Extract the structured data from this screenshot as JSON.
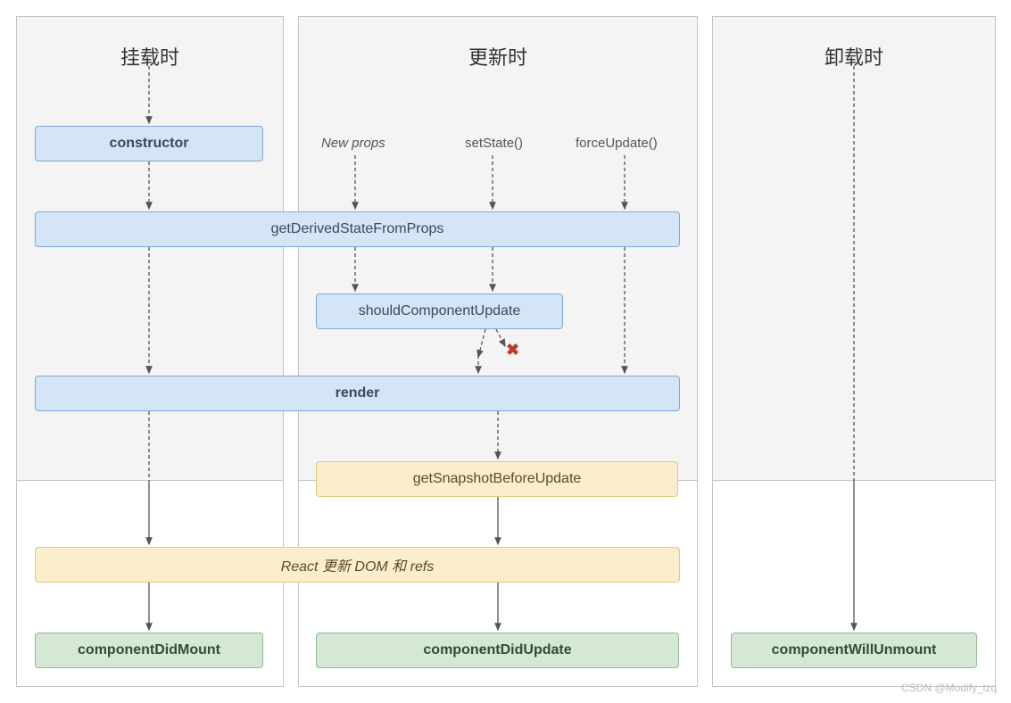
{
  "columns": {
    "mount": {
      "title": "挂载时"
    },
    "update": {
      "title": "更新时"
    },
    "unmount": {
      "title": "卸载时"
    }
  },
  "triggers": {
    "newProps": "New props",
    "setState": "setState()",
    "forceUpdate": "forceUpdate()"
  },
  "boxes": {
    "constructor": "constructor",
    "getDerived": "getDerivedStateFromProps",
    "shouldUpdate": "shouldComponentUpdate",
    "render": "render",
    "getSnapshot": "getSnapshotBeforeUpdate",
    "reactUpdatesDom": "React 更新 DOM 和 refs",
    "didMount": "componentDidMount",
    "didUpdate": "componentDidUpdate",
    "willUnmount": "componentWillUnmount"
  },
  "watermark": "CSDN @Modify_lzq",
  "xMarker": "✖"
}
